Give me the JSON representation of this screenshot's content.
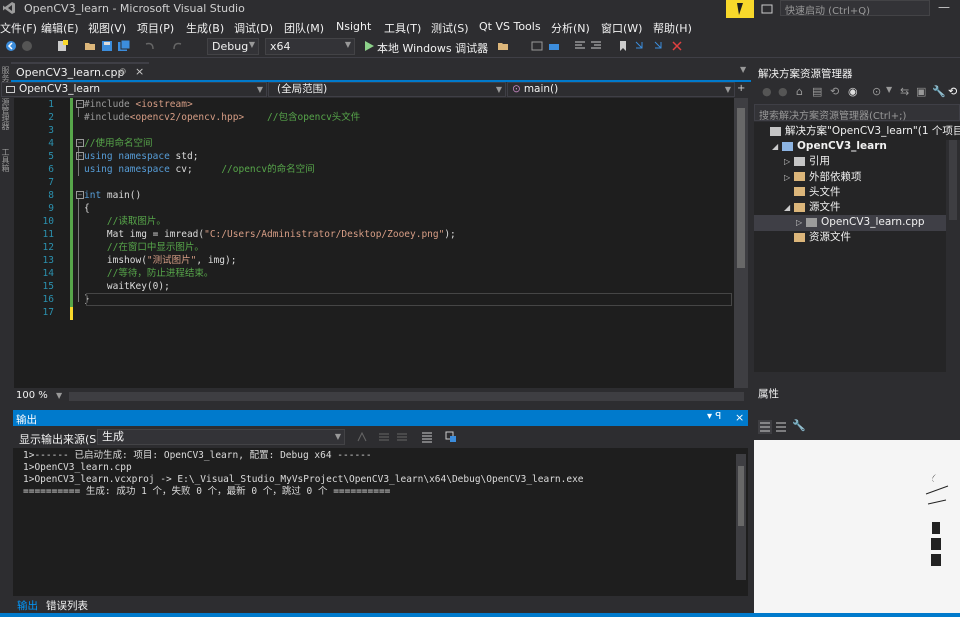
{
  "titlebar": {
    "title": "OpenCV3_learn - Microsoft Visual Studio",
    "quick_launch_placeholder": "快速启动 (Ctrl+Q)",
    "minimize_glyph": "—"
  },
  "menu": [
    "文件(F)",
    "编辑(E)",
    "视图(V)",
    "项目(P)",
    "生成(B)",
    "调试(D)",
    "团队(M)",
    "Nsight",
    "工具(T)",
    "测试(S)",
    "Qt VS Tools",
    "分析(N)",
    "窗口(W)",
    "帮助(H)"
  ],
  "toolbar": {
    "configuration": "Debug",
    "platform": "x64",
    "run_label": "本地 Windows 调试器"
  },
  "left_strip": [
    "服务器资源管理器",
    "工具箱"
  ],
  "doc_tab": {
    "label": "OpenCV3_learn.cpp",
    "pin": "⊕",
    "close": "×"
  },
  "navbar": {
    "project": "OpenCV3_learn",
    "scope": "(全局范围)",
    "member": "main()"
  },
  "editor": {
    "line_numbers": [
      "1",
      "2",
      "3",
      "4",
      "5",
      "6",
      "7",
      "8",
      "9",
      "10",
      "11",
      "12",
      "13",
      "14",
      "15",
      "16",
      "17"
    ],
    "lines": [
      {
        "segs": [
          {
            "c": "pp",
            "t": "#include "
          },
          {
            "c": "str",
            "t": "<iostream>"
          }
        ]
      },
      {
        "segs": [
          {
            "c": "pp",
            "t": "#include"
          },
          {
            "c": "str",
            "t": "<opencv2/opencv.hpp>"
          },
          {
            "c": "",
            "t": "    "
          },
          {
            "c": "cm",
            "t": "//包含opencv头文件"
          }
        ]
      },
      {
        "segs": []
      },
      {
        "segs": [
          {
            "c": "cm",
            "t": "//使用命名空间"
          }
        ]
      },
      {
        "segs": [
          {
            "c": "kw",
            "t": "using"
          },
          {
            "c": "",
            "t": " "
          },
          {
            "c": "kw",
            "t": "namespace"
          },
          {
            "c": "",
            "t": " std;"
          }
        ]
      },
      {
        "segs": [
          {
            "c": "kw",
            "t": "using"
          },
          {
            "c": "",
            "t": " "
          },
          {
            "c": "kw",
            "t": "namespace"
          },
          {
            "c": "",
            "t": " cv;     "
          },
          {
            "c": "cm",
            "t": "//opencv的命名空间"
          }
        ]
      },
      {
        "segs": []
      },
      {
        "segs": [
          {
            "c": "kw",
            "t": "int"
          },
          {
            "c": "",
            "t": " main()"
          }
        ]
      },
      {
        "segs": [
          {
            "c": "",
            "t": "{"
          }
        ]
      },
      {
        "segs": [
          {
            "c": "",
            "t": "    "
          },
          {
            "c": "cm",
            "t": "//读取图片。"
          }
        ]
      },
      {
        "segs": [
          {
            "c": "",
            "t": "    Mat img = imread("
          },
          {
            "c": "str",
            "t": "\"C:/Users/Administrator/Desktop/Zooey.png\""
          },
          {
            "c": "",
            "t": ");"
          }
        ]
      },
      {
        "segs": [
          {
            "c": "",
            "t": "    "
          },
          {
            "c": "cm",
            "t": "//在窗口中显示图片。"
          }
        ]
      },
      {
        "segs": [
          {
            "c": "",
            "t": "    imshow("
          },
          {
            "c": "str",
            "t": "\"测试图片\""
          },
          {
            "c": "",
            "t": ", img);"
          }
        ]
      },
      {
        "segs": [
          {
            "c": "",
            "t": "    "
          },
          {
            "c": "cm",
            "t": "//等待，防止进程结束。"
          }
        ]
      },
      {
        "segs": [
          {
            "c": "",
            "t": "    waitKey(0);"
          }
        ]
      },
      {
        "segs": [
          {
            "c": "",
            "t": "}"
          }
        ]
      },
      {
        "segs": []
      }
    ],
    "zoom": "100 %"
  },
  "output": {
    "title": "输出",
    "pin": "▾ ꟼ",
    "close": "×",
    "source_label": "显示输出来源(S):",
    "source_value": "生成",
    "lines": [
      "1>------ 已启动生成: 项目: OpenCV3_learn, 配置: Debug x64 ------",
      "1>OpenCV3_learn.cpp",
      "1>OpenCV3_learn.vcxproj -> E:\\_Visual_Studio_MyVsProject\\OpenCV3_learn\\x64\\Debug\\OpenCV3_learn.exe",
      "========== 生成: 成功 1 个，失败 0 个，最新 0 个，跳过 0 个 =========="
    ]
  },
  "bottom_tabs": [
    "输出",
    "错误列表"
  ],
  "solution_explorer": {
    "title": "解决方案资源管理器",
    "search_placeholder": "搜索解决方案资源管理器(Ctrl+;)",
    "nodes": [
      {
        "label": "解决方案\"OpenCV3_learn\"(1 个项目)",
        "level": 0,
        "exp": "",
        "icon": "solution-icon",
        "color": "#c5c5c5",
        "bold": false
      },
      {
        "label": "OpenCV3_learn",
        "level": 1,
        "exp": "◢",
        "icon": "project-icon",
        "color": "#8db4e2",
        "bold": true
      },
      {
        "label": "引用",
        "level": 2,
        "exp": "▷",
        "icon": "references-icon",
        "color": "#c5c5c5",
        "bold": false
      },
      {
        "label": "外部依赖项",
        "level": 2,
        "exp": "▷",
        "icon": "folder-icon",
        "color": "#dcb67a",
        "bold": false
      },
      {
        "label": "头文件",
        "level": 2,
        "exp": "",
        "icon": "folder-icon",
        "color": "#dcb67a",
        "bold": false
      },
      {
        "label": "源文件",
        "level": 2,
        "exp": "◢",
        "icon": "folder-icon",
        "color": "#dcb67a",
        "bold": false
      },
      {
        "label": "OpenCV3_learn.cpp",
        "level": 3,
        "exp": "▷",
        "icon": "cpp-file-icon",
        "color": "#9b9b9b",
        "bold": false
      },
      {
        "label": "资源文件",
        "level": 2,
        "exp": "",
        "icon": "folder-icon",
        "color": "#dcb67a",
        "bold": false
      }
    ]
  },
  "properties": {
    "title": "属性"
  },
  "colors": {
    "accent": "#007acc",
    "background": "#2d2d30",
    "editor_bg": "#1e1e1e",
    "notification": "#f8d82b"
  }
}
